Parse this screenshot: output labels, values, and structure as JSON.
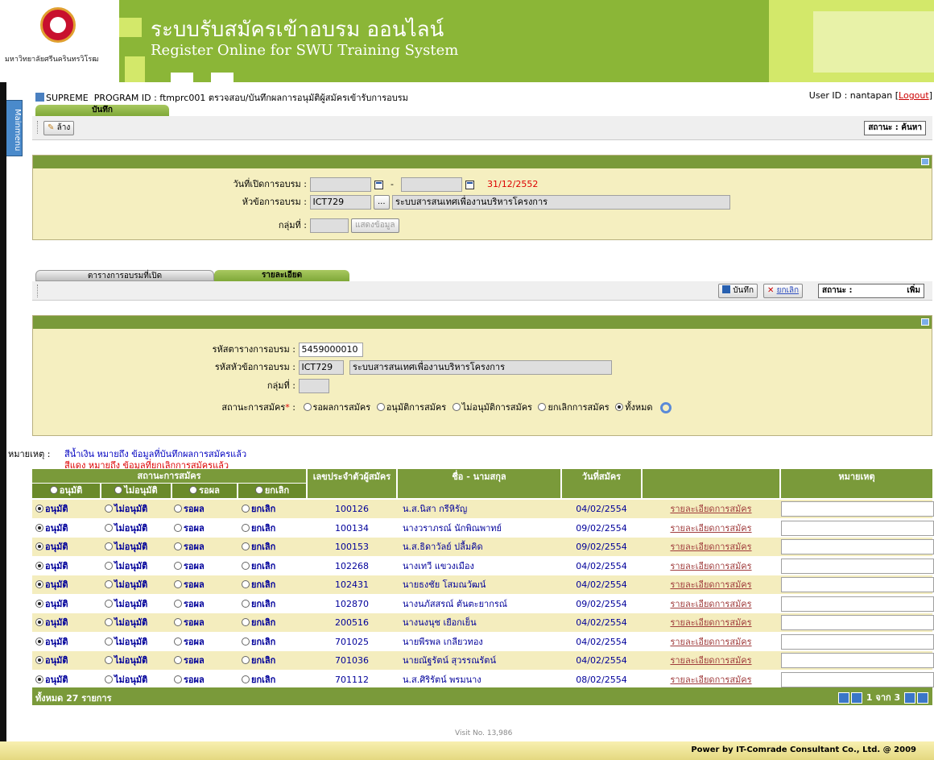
{
  "header": {
    "title_th": "ระบบรับสมัครเข้าอบรม ออนไลน์",
    "title_en": "Register Online for SWU Training System",
    "logo_text": "มหาวิทยาลัยศรีนครินทรวิโรฒ"
  },
  "nav": {
    "mainmenu": "Mainmenu"
  },
  "program": {
    "system": "SUPREME",
    "id_label": "PROGRAM ID :",
    "id": "ftmprc001",
    "description": "ตรวจสอบ/บันทึกผลการอนุมัติผู้สมัครเข้ารับการอบรม",
    "user_label": "User ID :",
    "user": "nantapan",
    "logout": "Logout"
  },
  "top_tab": {
    "label": "บันทึก"
  },
  "toolbar1": {
    "clear": "ล้าง",
    "status": "สถานะ : ค้นหา"
  },
  "search": {
    "open_date_label": "วันที่เปิดการอบรม :",
    "date_from": "",
    "date_to": "",
    "date_hint": "31/12/2552",
    "topic_label": "หัวข้อการอบรม :",
    "topic_code": "ICT729",
    "topic_more": "...",
    "topic_name": "ระบบสารสนเทศเพื่องานบริหารโครงการ",
    "group_label": "กลุ่มที่ :",
    "group_value": "",
    "show_button": "แสดงข้อมูล"
  },
  "tabs2": {
    "schedule": "ตารางการอบรมที่เปิด",
    "detail": "รายละเอียด"
  },
  "toolbar2": {
    "save": "บันทึก",
    "cancel": "ยกเลิก",
    "status": "สถานะ :",
    "status_value": "เพิ่ม"
  },
  "detail": {
    "schedule_code_label": "รหัสตารางการอบรม :",
    "schedule_code": "5459000010",
    "topic_code_label": "รหัสหัวข้อการอบรม :",
    "topic_code": "ICT729",
    "topic_name": "ระบบสารสนเทศเพื่องานบริหารโครงการ",
    "group_label": "กลุ่มที่ :",
    "group_value": "",
    "status_label": "สถานะการสมัคร",
    "status_options": [
      "รอผลการสมัคร",
      "อนุมัติการสมัคร",
      "ไม่อนุมัติการสมัคร",
      "ยกเลิกการสมัคร",
      "ทั้งหมด"
    ]
  },
  "notes": {
    "label": "หมายเหตุ :",
    "blue": "สีน้ำเงิน หมายถึง ข้อมูลที่บันทึกผลการสมัครแล้ว",
    "red": "สีแดง หมายถึง ข้อมูลที่ยกเลิกการสมัครแล้ว"
  },
  "table": {
    "group_header": "สถานะการสมัคร",
    "sub_headers": [
      "อนุมัติ",
      "ไม่อนุมัติ",
      "รอผล",
      "ยกเลิก"
    ],
    "col_id": "เลขประจำตัวผู้สมัคร",
    "col_name": "ชื่อ - นามสกุล",
    "col_date": "วันที่สมัคร",
    "col_remark": "หมายเหตุ",
    "detail_link": "รายละเอียดการสมัคร",
    "rows": [
      {
        "id": "100126",
        "name": "น.ส.นิสา กรีหิรัญ",
        "date": "04/02/2554"
      },
      {
        "id": "100134",
        "name": "นางวราภรณ์ นักพิณพาทย์",
        "date": "09/02/2554"
      },
      {
        "id": "100153",
        "name": "น.ส.ธิดาวัลย์ ปลื้มคิด",
        "date": "09/02/2554"
      },
      {
        "id": "102268",
        "name": "นางเทวี แขวงเมือง",
        "date": "04/02/2554"
      },
      {
        "id": "102431",
        "name": "นายธงชัย โสมณวัฒน์",
        "date": "04/02/2554"
      },
      {
        "id": "102870",
        "name": "นางนภัสสรณ์ ตันตะยากรณ์",
        "date": "09/02/2554"
      },
      {
        "id": "200516",
        "name": "นางนงนุช เยือกเย็น",
        "date": "04/02/2554"
      },
      {
        "id": "701025",
        "name": "นายพีรพล เกลียวทอง",
        "date": "04/02/2554"
      },
      {
        "id": "701036",
        "name": "นายณัฐรัตน์ สุวรรณรัตน์",
        "date": "04/02/2554"
      },
      {
        "id": "701112",
        "name": "น.ส.ศิริรัตน์ พรมนาง",
        "date": "08/02/2554"
      }
    ],
    "footer_total": "ทั้งหมด  27  รายการ",
    "pager_text": "1 จาก 3"
  },
  "visit": "Visit No. 13,986",
  "footer": "Power by IT-Comrade Consultant Co., Ltd. @ 2009",
  "colors": {
    "green": "#7a9a3a",
    "panel": "#f5efc0",
    "blue_text": "#00009a"
  }
}
